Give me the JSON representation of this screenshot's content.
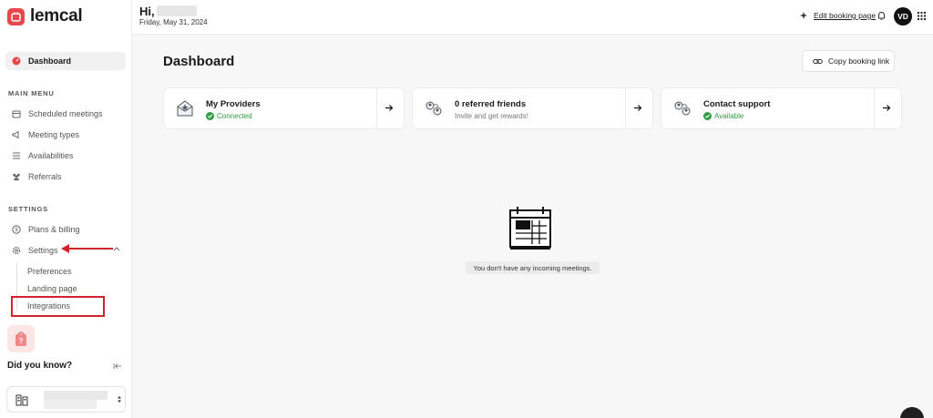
{
  "brand": {
    "name": "lemcal",
    "accent": "#e8484a"
  },
  "sidebar": {
    "dashboard": "Dashboard",
    "main_menu_label": "MAIN MENU",
    "main_menu": [
      {
        "label": "Scheduled meetings",
        "icon": "calendar-icon"
      },
      {
        "label": "Meeting types",
        "icon": "megaphone-icon"
      },
      {
        "label": "Availabilities",
        "icon": "list-icon"
      },
      {
        "label": "Referrals",
        "icon": "users-icon"
      }
    ],
    "settings_label": "SETTINGS",
    "settings_menu": [
      {
        "label": "Plans & billing",
        "icon": "dollar-circle-icon"
      },
      {
        "label": "Settings",
        "icon": "gear-icon"
      }
    ],
    "settings_sub": [
      "Preferences",
      "Landing page",
      "Integrations"
    ],
    "did_you_know": "Did you know?"
  },
  "header": {
    "greeting": "Hi,",
    "date": "Friday, May 31, 2024",
    "edit_booking": "Edit booking page",
    "avatar_initials": "VD"
  },
  "main": {
    "title": "Dashboard",
    "copy_link": "Copy booking link",
    "cards": [
      {
        "title": "My Providers",
        "sub": "Connected",
        "status": "ok"
      },
      {
        "title": "0 referred friends",
        "sub": "Invite and get rewards!",
        "status": "none"
      },
      {
        "title": "Contact support",
        "sub": "Available",
        "status": "ok"
      }
    ],
    "empty_text": "You don't have any incoming meetings."
  },
  "colors": {
    "success": "#2f9e44",
    "annotation": "#d0262b"
  }
}
